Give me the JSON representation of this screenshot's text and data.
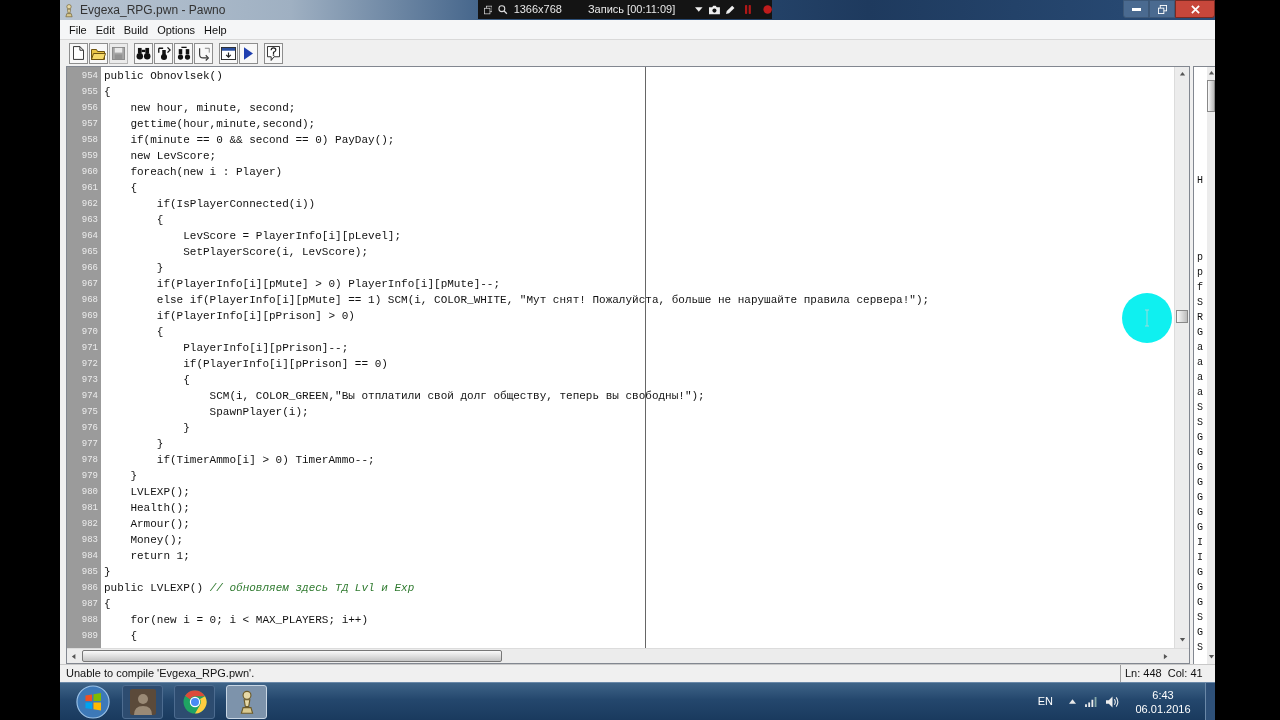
{
  "window": {
    "title": "Evgexa_RPG.pwn - Pawno"
  },
  "recorder_overlay": {
    "resolution": "1366x768",
    "recording": "Запись [00:11:09]"
  },
  "menu": [
    "File",
    "Edit",
    "Build",
    "Options",
    "Help"
  ],
  "toolbar": [
    [
      {
        "kind": "new",
        "disabled": false
      },
      {
        "kind": "open",
        "disabled": false
      },
      {
        "kind": "save",
        "disabled": true
      }
    ],
    [
      {
        "kind": "find",
        "disabled": false
      },
      {
        "kind": "find_next",
        "disabled": false
      },
      {
        "kind": "replace",
        "disabled": false
      },
      {
        "kind": "goto",
        "disabled": false
      }
    ],
    [
      {
        "kind": "compile",
        "disabled": false
      },
      {
        "kind": "run",
        "disabled": false
      }
    ],
    [
      {
        "kind": "help",
        "disabled": false
      }
    ]
  ],
  "editor": {
    "lines": [
      {
        "number": "954",
        "code": "public Obnovlsek()"
      },
      {
        "number": "955",
        "code": "{"
      },
      {
        "number": "956",
        "code": "    new hour, minute, second;"
      },
      {
        "number": "957",
        "code": "    gettime(hour,minute,second);"
      },
      {
        "number": "958",
        "code": "    if(minute == 0 && second == 0) PayDay();"
      },
      {
        "number": "959",
        "code": "    new LevScore;"
      },
      {
        "number": "960",
        "code": "    foreach(new i : Player)"
      },
      {
        "number": "961",
        "code": "    {"
      },
      {
        "number": "962",
        "code": "        if(IsPlayerConnected(i))"
      },
      {
        "number": "963",
        "code": "        {"
      },
      {
        "number": "964",
        "code": "            LevScore = PlayerInfo[i][pLevel];"
      },
      {
        "number": "965",
        "code": "            SetPlayerScore(i, LevScore);"
      },
      {
        "number": "966",
        "code": "        }"
      },
      {
        "number": "967",
        "code": "        if(PlayerInfo[i][pMute] > 0) PlayerInfo[i][pMute]--;"
      },
      {
        "number": "968",
        "code": "        else if(PlayerInfo[i][pMute] == 1) SCM(i, COLOR_WHITE, \"Мут снят! Пожалуйста, больше не нарушайте правила сервера!\");"
      },
      {
        "number": "969",
        "code": "        if(PlayerInfo[i][pPrison] > 0)"
      },
      {
        "number": "970",
        "code": "        {"
      },
      {
        "number": "971",
        "code": "            PlayerInfo[i][pPrison]--;"
      },
      {
        "number": "972",
        "code": "            if(PlayerInfo[i][pPrison] == 0)"
      },
      {
        "number": "973",
        "code": "            {"
      },
      {
        "number": "974",
        "code": "                SCM(i, COLOR_GREEN,\"Вы отплатили свой долг обществу, теперь вы свободны!\");"
      },
      {
        "number": "975",
        "code": "                SpawnPlayer(i);"
      },
      {
        "number": "976",
        "code": "            }"
      },
      {
        "number": "977",
        "code": "        }"
      },
      {
        "number": "978",
        "code": "        if(TimerAmmo[i] > 0) TimerAmmo--;"
      },
      {
        "number": "979",
        "code": "    }"
      },
      {
        "number": "980",
        "code": "    LVLEXP();"
      },
      {
        "number": "981",
        "code": "    Health();"
      },
      {
        "number": "982",
        "code": "    Armour();"
      },
      {
        "number": "983",
        "code": "    Money();"
      },
      {
        "number": "984",
        "code": "    return 1;"
      },
      {
        "number": "985",
        "code": "}"
      },
      {
        "number": "986",
        "code": "public LVLEXP()",
        "comment": "// обновляем здесь ТД Lvl и Exp"
      },
      {
        "number": "987",
        "code": "{"
      },
      {
        "number": "988",
        "code": "    for(new i = 0; i < MAX_PLAYERS; i++)"
      },
      {
        "number": "989",
        "code": "    {"
      }
    ]
  },
  "function_panel": {
    "groups": [
      [
        "H"
      ],
      [
        "p",
        "p",
        "f",
        "S",
        "R",
        "G",
        "a",
        "a",
        "a",
        "a",
        "S",
        "S",
        "G",
        "G",
        "G",
        "G",
        "G",
        "G",
        "G",
        "I",
        "I",
        "G",
        "G",
        "G",
        "S",
        "G",
        "S"
      ]
    ]
  },
  "status_bar": {
    "message": "Unable to compile 'Evgexa_RPG.pwn'.",
    "position": "Ln: 448  Col: 41"
  },
  "taskbar": {
    "apps": [
      {
        "kind": "game",
        "selected": false
      },
      {
        "kind": "chrome",
        "selected": false
      },
      {
        "kind": "pawno",
        "selected": true
      }
    ],
    "language": "EN",
    "time": "6:43",
    "date": "06.01.2016"
  }
}
